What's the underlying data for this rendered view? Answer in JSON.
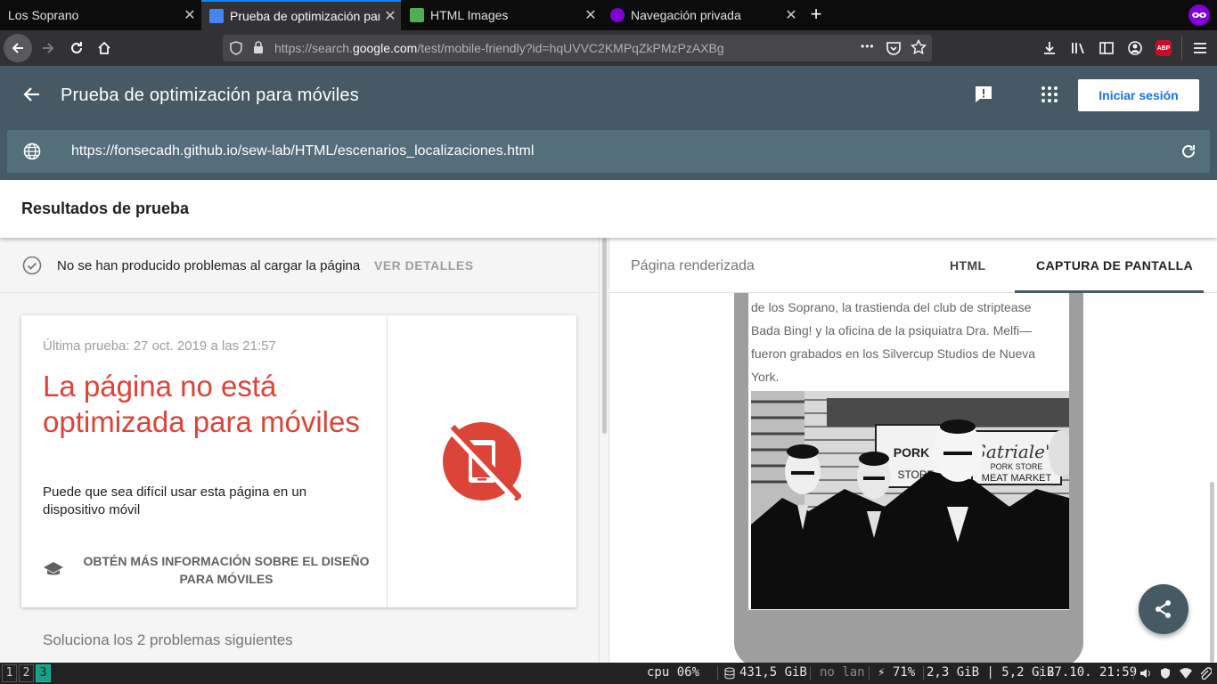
{
  "browser": {
    "tabs": [
      {
        "title": "Los Soprano",
        "active": false,
        "favicon_color": "#0c0c0d"
      },
      {
        "title": "Prueba de optimización para",
        "active": true,
        "favicon_color": "#4285f4"
      },
      {
        "title": "HTML Images",
        "active": false,
        "favicon_color": "#4caf50"
      },
      {
        "title": "Navegación privada",
        "active": false,
        "favicon_color": "#8000d7"
      }
    ],
    "tab_close_glyph": "✕",
    "new_tab_glyph": "+",
    "url_prefix": "https://search.",
    "url_domain": "google.com",
    "url_rest": "/test/mobile-friendly?id=hqUVVC2KMPqZkPMzPzAXBg",
    "more_glyph": "•••",
    "abp_label": "ABP"
  },
  "app": {
    "title": "Prueba de optimización para móviles",
    "login_label": "Iniciar sesión",
    "tested_url": "https://fonsecadh.github.io/sew-lab/HTML/escenarios_localizaciones.html"
  },
  "results": {
    "heading": "Resultados de prueba",
    "status_text": "No se han producido problemas al cargar la página",
    "details_label": "VER DETALLES",
    "last_test": "Última prueba: 27 oct. 2019 a las 21:57",
    "headline": "La página no está optimizada para móviles",
    "subline": "Puede que sea difícil usar esta página en un dispositivo móvil",
    "learn_more": "OBTÉN MÁS INFORMACIÓN SOBRE EL DISEÑO PARA MÓVILES",
    "fix_label": "Soluciona los 2 problemas siguientes"
  },
  "preview": {
    "rendered_label": "Página renderizada",
    "tab_html": "HTML",
    "tab_screenshot": "CAPTURA DE PANTALLA",
    "page_text": "de los Soprano, la trastienda del club de striptease Bada Bing! y la oficina de la psiquiatra Dra. Melfi—fueron grabados en los Silvercup Studios de Nueva York.",
    "photo_sign_1": "PORK STORE",
    "photo_sign_2": "MEAT MARKET",
    "photo_sign_3": "Satriale's",
    "photo_sign_4": "PORK",
    "photo_sign_5": "STORE"
  },
  "taskbar": {
    "workspaces": [
      "1",
      "2",
      "3"
    ],
    "active_workspace": "3",
    "cpu": "cpu  06%",
    "disk": "431,5 GiB",
    "net": "no lan",
    "battery": "⚡ 71%",
    "memory": "2,3 GiB | 5,2 GiB",
    "clock": "27.10. 21:59"
  },
  "colors": {
    "header_bg": "#455a64",
    "url_bar_bg": "#546e7a",
    "error_red": "#db4437",
    "accent_blue": "#1a73e8"
  }
}
